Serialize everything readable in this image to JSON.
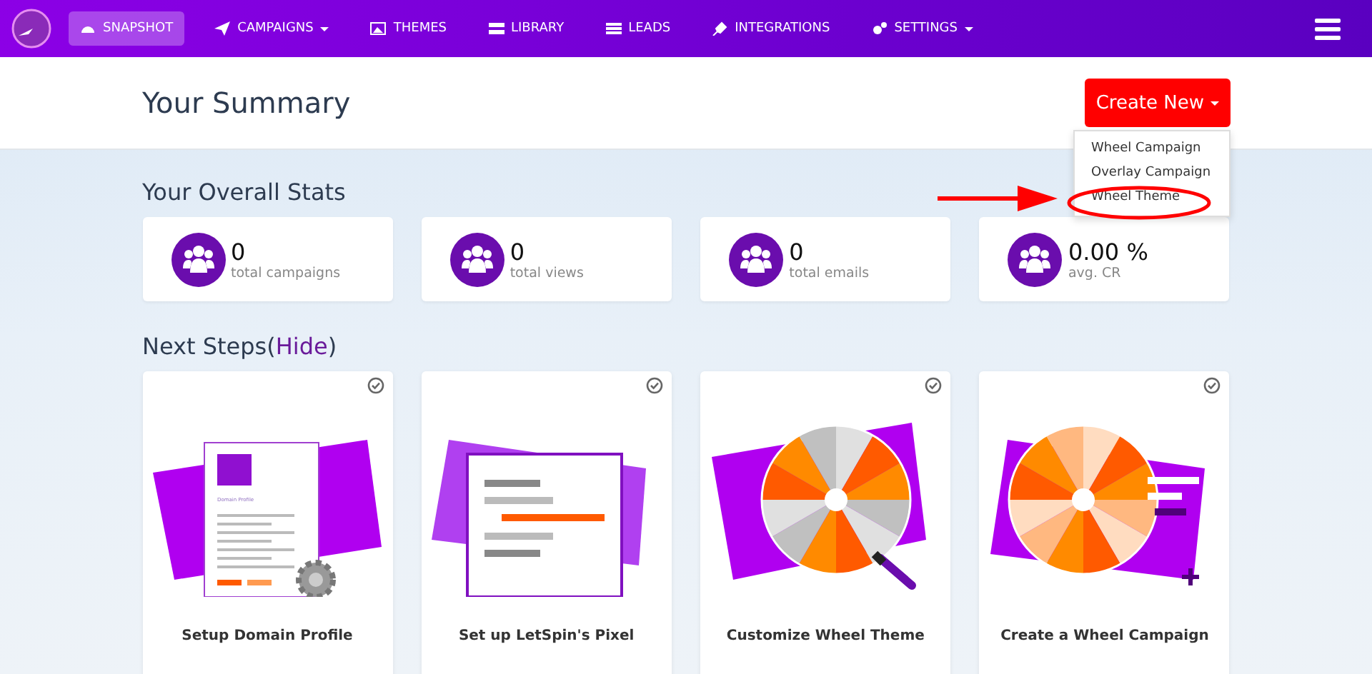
{
  "nav": {
    "items": [
      {
        "label": "SNAPSHOT",
        "selected": true,
        "has_menu": false
      },
      {
        "label": "CAMPAIGNS",
        "selected": false,
        "has_menu": true
      },
      {
        "label": "THEMES",
        "selected": false,
        "has_menu": false
      },
      {
        "label": "LIBRARY",
        "selected": false,
        "has_menu": false
      },
      {
        "label": "LEADS",
        "selected": false,
        "has_menu": false
      },
      {
        "label": "INTEGRATIONS",
        "selected": false,
        "has_menu": false
      },
      {
        "label": "SETTINGS",
        "selected": false,
        "has_menu": true
      }
    ]
  },
  "header": {
    "title": "Your Summary",
    "create_button": "Create New",
    "menu": [
      {
        "label": "Wheel Campaign",
        "annotated": false
      },
      {
        "label": "Overlay Campaign",
        "annotated": false
      },
      {
        "label": "Wheel Theme",
        "annotated": true
      }
    ]
  },
  "stats": {
    "title": "Your Overall Stats",
    "cards": [
      {
        "value": "0",
        "label": "total campaigns"
      },
      {
        "value": "0",
        "label": "total views"
      },
      {
        "value": "0",
        "label": "total emails"
      },
      {
        "value": "0.00 %",
        "label": "avg. CR"
      }
    ]
  },
  "next_steps": {
    "title": "Next Steps",
    "paren_open": "(",
    "hide_link": "Hide",
    "paren_close": ")",
    "cards": [
      {
        "kind": "profile",
        "title": "Setup Domain Profile",
        "illustration_text": "Domain Profile"
      },
      {
        "kind": "pixel",
        "title": "Set up LetSpin's Pixel"
      },
      {
        "kind": "theme",
        "title": "Customize Wheel Theme"
      },
      {
        "kind": "campaign",
        "title": "Create a Wheel Campaign"
      }
    ]
  }
}
